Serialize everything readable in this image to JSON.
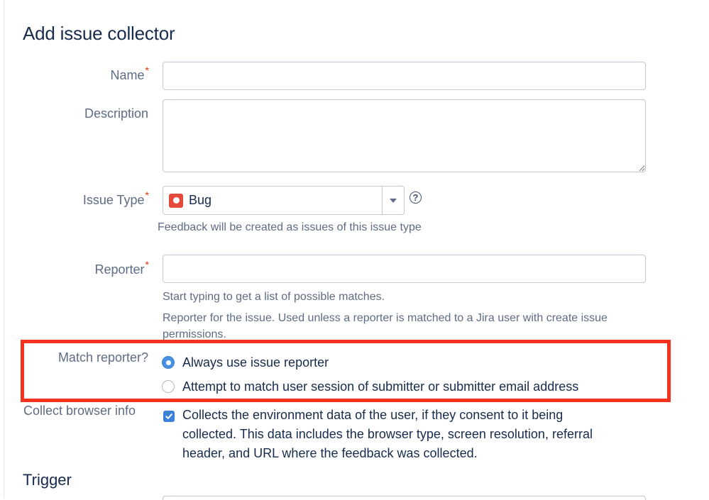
{
  "page": {
    "title": "Add issue collector",
    "section_trigger": "Trigger"
  },
  "fields": {
    "name": {
      "label": "Name",
      "required_mark": "*",
      "value": ""
    },
    "description": {
      "label": "Description",
      "value": ""
    },
    "issue_type": {
      "label": "Issue Type",
      "required_mark": "*",
      "selected": "Bug",
      "icon": "bug-icon",
      "help_icon": "?",
      "help": "Feedback will be created as issues of this issue type"
    },
    "reporter": {
      "label": "Reporter",
      "required_mark": "*",
      "value": "",
      "help1": "Start typing to get a list of possible matches.",
      "help2_line1": "Reporter for the issue. Used unless a reporter is matched to a Jira user with create issue",
      "help2_line2": "permissions."
    },
    "match_reporter": {
      "label": "Match reporter?",
      "options": [
        {
          "label": "Always use issue reporter",
          "selected": true
        },
        {
          "label": "Attempt to match user session of submitter or submitter email address",
          "selected": false
        }
      ]
    },
    "collect_browser": {
      "label": "Collect browser info",
      "checked": true,
      "lines": [
        "Collects the environment data of the user, if they consent to it being",
        "collected. This data includes the browser type, screen resolution, referral",
        "header, and URL where the feedback was collected."
      ]
    }
  },
  "colors": {
    "highlight": "#f5321e",
    "accent": "#4a90e2",
    "required": "#de350b",
    "bug": "#e5493a"
  }
}
